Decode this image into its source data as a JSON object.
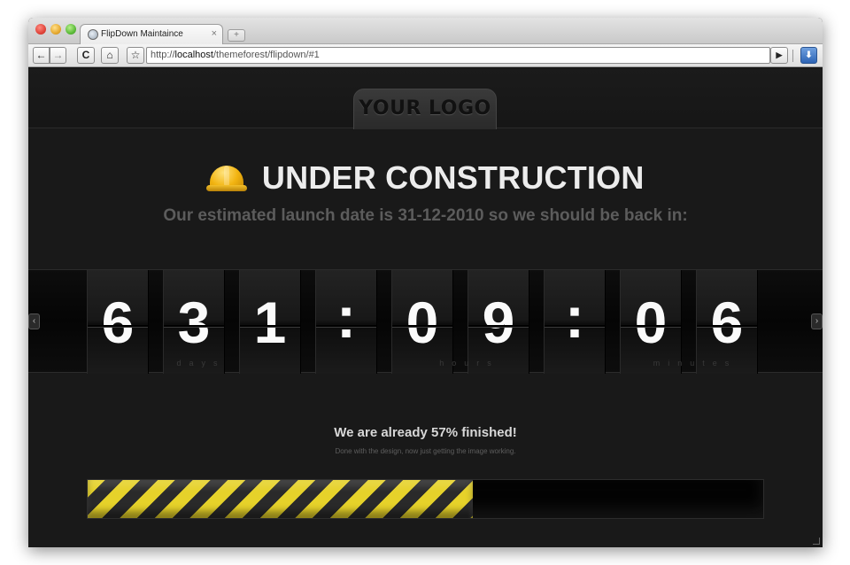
{
  "browser": {
    "tab_title": "FlipDown Maintaince",
    "tab_close": "×",
    "new_tab": "+",
    "url_scheme": "http://",
    "url_host": "localhost",
    "url_path": "/themeforest/flipdown/#1",
    "icons": {
      "back": "←",
      "forward": "→",
      "reload": "C",
      "home": "⌂",
      "star": "☆",
      "go": "▶",
      "download": "⬇"
    }
  },
  "page": {
    "logo_text": "YOUR LOGO",
    "title": "UNDER CONSTRUCTION",
    "subtitle": "Our estimated launch date is 31-12-2010 so we should be back in:",
    "countdown": {
      "d1": "6",
      "d2": "3",
      "d3": "1",
      "sep1": ":",
      "h1": "0",
      "h2": "9",
      "sep2": ":",
      "m1": "0",
      "m2": "6",
      "labels": {
        "days": "days",
        "hours": "hours",
        "minutes": "minutes"
      },
      "arrow_left": "‹",
      "arrow_right": "›"
    },
    "progress": {
      "title": "We are already 57% finished!",
      "subtitle": "Done with the design, now just getting the image working.",
      "percent": 57,
      "stripe_color": "#e6d22a"
    }
  }
}
